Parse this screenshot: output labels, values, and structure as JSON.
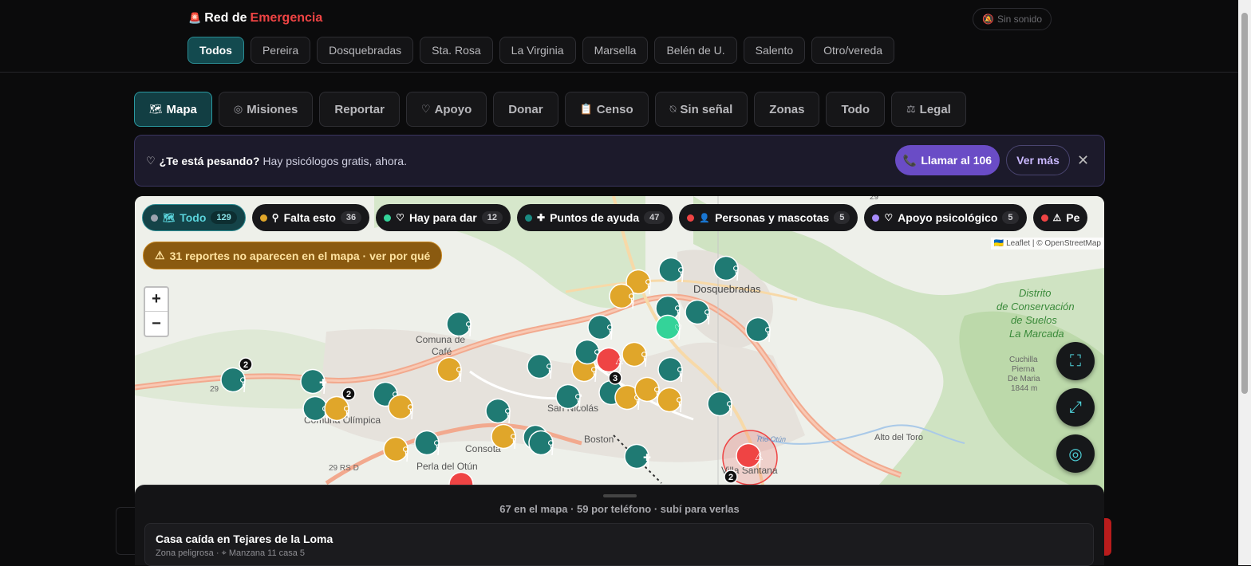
{
  "brand": {
    "icon": "siren-icon",
    "prefix": "Red de",
    "accent": "Emergencia",
    "accent_color": "#ef4444"
  },
  "sound_toggle": {
    "icon": "bell-off-icon",
    "label": "Sin sonido"
  },
  "cities": [
    "Todos",
    "Pereira",
    "Dosquebradas",
    "Sta. Rosa",
    "La Virginia",
    "Marsella",
    "Belén de U.",
    "Salento",
    "Otro/vereda"
  ],
  "tabs": [
    {
      "label": "Mapa",
      "icon": "map-icon",
      "glyph": "🗺"
    },
    {
      "label": "Misiones",
      "icon": "target-icon",
      "glyph": "◎"
    },
    {
      "label": "Reportar",
      "icon": "",
      "glyph": ""
    },
    {
      "label": "Apoyo",
      "icon": "heart-icon",
      "glyph": "♡"
    },
    {
      "label": "Donar",
      "icon": "",
      "glyph": ""
    },
    {
      "label": "Censo",
      "icon": "clipboard-icon",
      "glyph": "📋"
    },
    {
      "label": "Sin señal",
      "icon": "no-signal-icon",
      "glyph": "⍉"
    },
    {
      "label": "Zonas",
      "icon": "",
      "glyph": ""
    },
    {
      "label": "Todo",
      "icon": "",
      "glyph": ""
    },
    {
      "label": "Legal",
      "icon": "scale-icon",
      "glyph": "⚖"
    }
  ],
  "banner": {
    "question": "¿Te está pesando?",
    "text": "Hay psicólogos gratis, ahora.",
    "call_label": "Llamar al 106",
    "more_label": "Ver más",
    "accent": "#6a4cc6"
  },
  "filters": [
    {
      "label": "Todo",
      "count": "129",
      "color": "#9ca3af",
      "icon": "map-icon",
      "glyph": "🗺"
    },
    {
      "label": "Falta esto",
      "count": "36",
      "color": "#e0a62a",
      "icon": "bandage-icon",
      "glyph": "⚲"
    },
    {
      "label": "Hay para dar",
      "count": "12",
      "color": "#34d399",
      "icon": "heart-icon",
      "glyph": "♡"
    },
    {
      "label": "Puntos de ayuda",
      "count": "47",
      "color": "#1a8a82",
      "icon": "cross-icon",
      "glyph": "✚"
    },
    {
      "label": "Personas y mascotas",
      "count": "5",
      "color": "#ef4444",
      "icon": "person-icon",
      "glyph": "👤"
    },
    {
      "label": "Apoyo psicológico",
      "count": "5",
      "color": "#a78bfa",
      "icon": "heart-icon",
      "glyph": "♡"
    },
    {
      "label": "Pe",
      "count": "",
      "color": "#ef4444",
      "icon": "warning-icon",
      "glyph": "⚠"
    }
  ],
  "map": {
    "warning": "31 reportes no aparecen en el mapa · ver por qué",
    "attribution": "🇺🇦 Leaflet | © OpenStreetMap",
    "zoom_in": "+",
    "zoom_out": "−",
    "places": [
      "Dosquebradas",
      "Comuna de",
      "Café",
      "Comuna Olímpica",
      "San Nicolás",
      "Boston",
      "Consota",
      "Perla del Otún",
      "Villa Santana",
      "Alto del Toro",
      "Río Otún",
      "Distrito",
      "de Conservación",
      "de Suelos",
      "La Marcada",
      "Cuchilla",
      "Pierna",
      "De Maria",
      "1844 m",
      "29",
      "29 RS D",
      "29"
    ],
    "cluster_counts": [
      "2",
      "2",
      "3",
      "2"
    ]
  },
  "sheet": {
    "info": "67 en el mapa · 59 por teléfono · subí para verlas",
    "card_title": "Casa caída en Tejares de la Loma",
    "card_category": "Zona peligrosa",
    "card_location": "Manzana 11 casa 5"
  }
}
